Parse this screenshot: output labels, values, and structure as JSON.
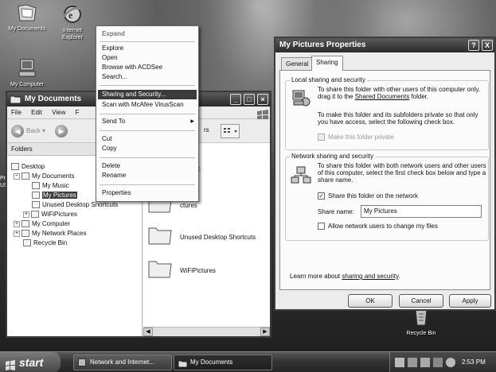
{
  "desktop": {
    "icons": [
      {
        "label": "My Documents"
      },
      {
        "label": "Internet Explorer"
      },
      {
        "label": "My Computer"
      },
      {
        "label": "Recycle Bin"
      }
    ],
    "partial_left_label": "Pr\nUS"
  },
  "explorer": {
    "title": "My Documents",
    "menu": [
      "File",
      "Edit",
      "View",
      "F"
    ],
    "back_label": "Back",
    "views_partial": "rs",
    "folders_header": "Folders",
    "tree": [
      {
        "label": "Desktop"
      },
      {
        "label": "My Documents"
      },
      {
        "label": "My Music"
      },
      {
        "label": "My Pictures"
      },
      {
        "label": "Unused Desktop Shortcuts"
      },
      {
        "label": "WiFiPictures"
      },
      {
        "label": "My Computer"
      },
      {
        "label": "My Network Places"
      },
      {
        "label": "Recycle Bin"
      }
    ],
    "content": [
      {
        "label": "ic"
      },
      {
        "label": "ctures"
      },
      {
        "label": "Unused Desktop Shortcuts"
      },
      {
        "label": "WiFiPictures"
      }
    ]
  },
  "context_menu": {
    "items": [
      {
        "label": "Expand"
      },
      {
        "label": "Explore"
      },
      {
        "label": "Open"
      },
      {
        "label": "Browse with ACDSee"
      },
      {
        "label": "Search..."
      },
      {
        "label": "Sharing and Security..."
      },
      {
        "label": "Scan with McAfee VirusScan"
      },
      {
        "label": "Send To"
      },
      {
        "label": "Cut"
      },
      {
        "label": "Copy"
      },
      {
        "label": "Delete"
      },
      {
        "label": "Rename"
      },
      {
        "label": "Properties"
      }
    ],
    "send_to_arrow": "▶"
  },
  "properties": {
    "title": "My Pictures Properties",
    "help_btn": "?",
    "close_btn": "X",
    "tabs": [
      "General",
      "Sharing"
    ],
    "local_group": {
      "title": "Local sharing and security",
      "text1": "To share this folder with other users of this computer only, drag it to the",
      "text1_link": "Shared Documents",
      "text1_end": "folder.",
      "text2": "To make this folder and its subfolders private so that only you have access, select the following check box.",
      "make_private_label": "Make this folder private"
    },
    "network_group": {
      "title": "Network sharing and security",
      "text": "To share this folder with both network users and other users of this computer, select the first check box below and type a share name.",
      "share_label": "Share this folder on the network",
      "share_name_label": "Share name:",
      "share_name_value": "My Pictures",
      "allow_change_label": "Allow network users to change my files"
    },
    "learn_more_prefix": "Learn more about",
    "learn_more_link": "sharing and security",
    "learn_more_suffix": ".",
    "buttons": {
      "ok": "OK",
      "cancel": "Cancel",
      "apply": "Apply"
    }
  },
  "taskbar": {
    "start": "start",
    "tasks": [
      {
        "label": "Network and Internet..."
      },
      {
        "label": "My Documents"
      }
    ],
    "clock": "2:53 PM"
  }
}
